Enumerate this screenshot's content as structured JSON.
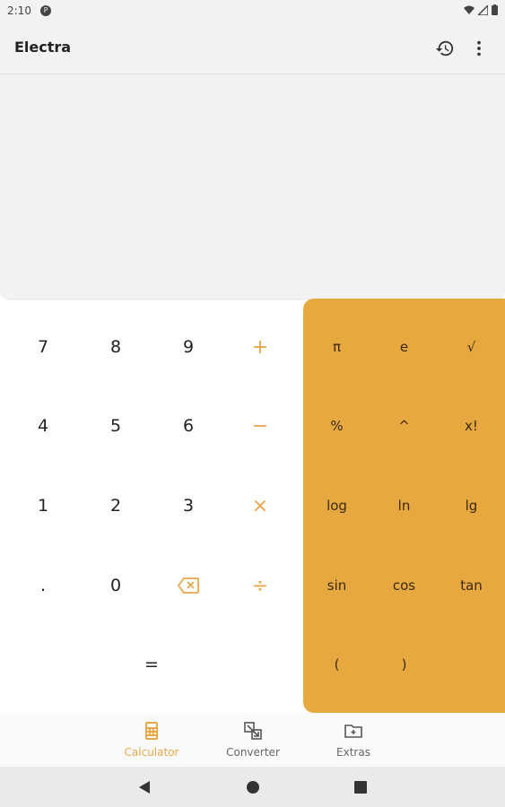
{
  "status_bar": {
    "time": "2:10",
    "app_badge": "P"
  },
  "app_bar": {
    "title": "Electra",
    "history_icon": "history-icon",
    "menu_icon": "more-vert-icon"
  },
  "keypad": {
    "row1": [
      "7",
      "8",
      "9",
      "+"
    ],
    "row2": [
      "4",
      "5",
      "6",
      "−"
    ],
    "row3": [
      "1",
      "2",
      "3",
      "×"
    ],
    "row4": [
      ".",
      "0",
      "⌫",
      "÷"
    ],
    "equals": "="
  },
  "scientific": {
    "row1": [
      "π",
      "e",
      "√"
    ],
    "row2": [
      "%",
      "^",
      "x!"
    ],
    "row3": [
      "log",
      "ln",
      "lg"
    ],
    "row4": [
      "sin",
      "cos",
      "tan"
    ],
    "row5": [
      "(",
      ")"
    ]
  },
  "bottom_nav": [
    {
      "label": "Calculator",
      "icon": "calculator-icon",
      "active": true
    },
    {
      "label": "Converter",
      "icon": "converter-icon",
      "active": false
    },
    {
      "label": "Extras",
      "icon": "extras-folder-icon",
      "active": false
    }
  ],
  "colors": {
    "accent": "#e8a840",
    "operator": "#e8a84a",
    "surface": "#f2f2f2"
  }
}
